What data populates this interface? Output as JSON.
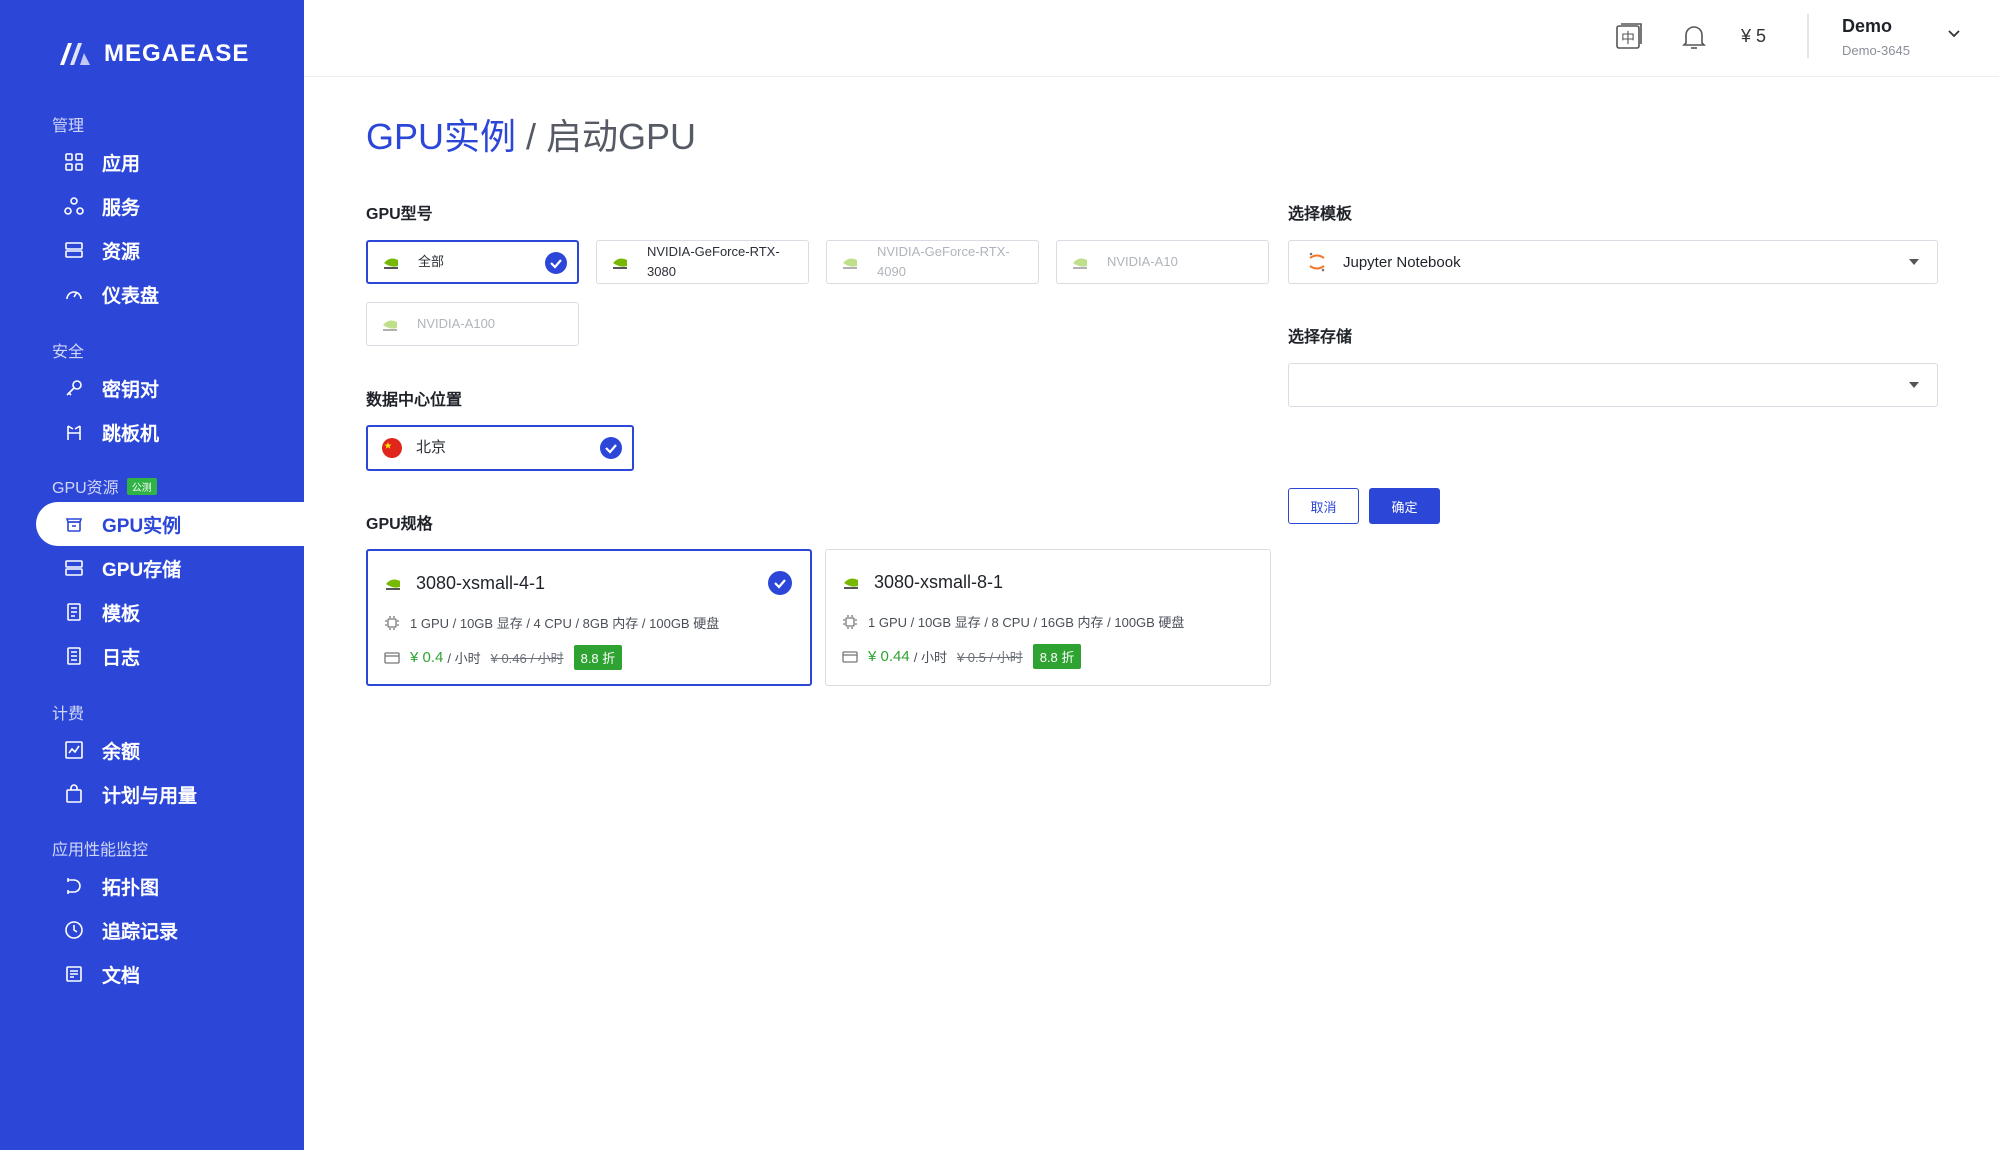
{
  "brand": {
    "name": "MEGAEASE"
  },
  "sidebar": {
    "sections": [
      {
        "label": "管理"
      },
      {
        "label": "安全"
      },
      {
        "label": "GPU资源",
        "badge": "公测"
      },
      {
        "label": "计费"
      },
      {
        "label": "应用性能监控"
      }
    ],
    "items": [
      {
        "label": "应用",
        "icon": "apps-icon"
      },
      {
        "label": "服务",
        "icon": "service-icon"
      },
      {
        "label": "资源",
        "icon": "resource-icon"
      },
      {
        "label": "仪表盘",
        "icon": "dashboard-icon"
      },
      {
        "label": "密钥对",
        "icon": "key-icon"
      },
      {
        "label": "跳板机",
        "icon": "bastion-icon"
      },
      {
        "label": "GPU实例",
        "icon": "gpu-instance-icon",
        "active": true
      },
      {
        "label": "GPU存储",
        "icon": "gpu-storage-icon"
      },
      {
        "label": "模板",
        "icon": "template-icon"
      },
      {
        "label": "日志",
        "icon": "log-icon"
      },
      {
        "label": "余额",
        "icon": "balance-icon"
      },
      {
        "label": "计划与用量",
        "icon": "plan-icon"
      },
      {
        "label": "拓扑图",
        "icon": "topology-icon"
      },
      {
        "label": "追踪记录",
        "icon": "trace-icon"
      },
      {
        "label": "文档",
        "icon": "docs-icon"
      }
    ]
  },
  "header": {
    "language_glyph": "中",
    "balance": "¥ 5",
    "user": {
      "name": "Demo",
      "id": "Demo-3645"
    }
  },
  "page": {
    "breadcrumb_parent": "GPU实例",
    "breadcrumb_sep": " / ",
    "breadcrumb_current": "启动GPU"
  },
  "gpu_model": {
    "label": "GPU型号",
    "options": [
      {
        "line1": "全部",
        "line2": "",
        "selected": true,
        "disabled": false
      },
      {
        "line1": "NVIDIA-GeForce-RTX-",
        "line2": "3080",
        "selected": false,
        "disabled": false
      },
      {
        "line1": "NVIDIA-GeForce-RTX-",
        "line2": "4090",
        "selected": false,
        "disabled": true
      },
      {
        "line1": "NVIDIA-A10",
        "line2": "",
        "selected": false,
        "disabled": true
      },
      {
        "line1": "NVIDIA-A100",
        "line2": "",
        "selected": false,
        "disabled": true
      }
    ]
  },
  "datacenter": {
    "label": "数据中心位置",
    "options": [
      {
        "label": "北京",
        "selected": true
      }
    ]
  },
  "gpu_spec": {
    "label": "GPU规格",
    "options": [
      {
        "name": "3080-xsmall-4-1",
        "detail": "1 GPU / 10GB 显存 / 4 CPU / 8GB 内存 / 100GB 硬盘",
        "price": "¥ 0.4",
        "unit": "/ 小时",
        "old_price": "¥ 0.46 / 小时",
        "discount": "8.8 折",
        "selected": true
      },
      {
        "name": "3080-xsmall-8-1",
        "detail": "1 GPU / 10GB 显存 / 8 CPU / 16GB 内存 / 100GB 硬盘",
        "price": "¥ 0.44",
        "unit": "/ 小时",
        "old_price": "¥ 0.5 / 小时",
        "discount": "8.8 折",
        "selected": false
      }
    ]
  },
  "template": {
    "label": "选择模板",
    "value": "Jupyter Notebook"
  },
  "storage": {
    "label": "选择存储",
    "value": ""
  },
  "actions": {
    "cancel": "取消",
    "confirm": "确定"
  },
  "colors": {
    "primary": "#2c47d8",
    "success": "#2fa332",
    "sidebar_bg": "#2c47d8"
  }
}
